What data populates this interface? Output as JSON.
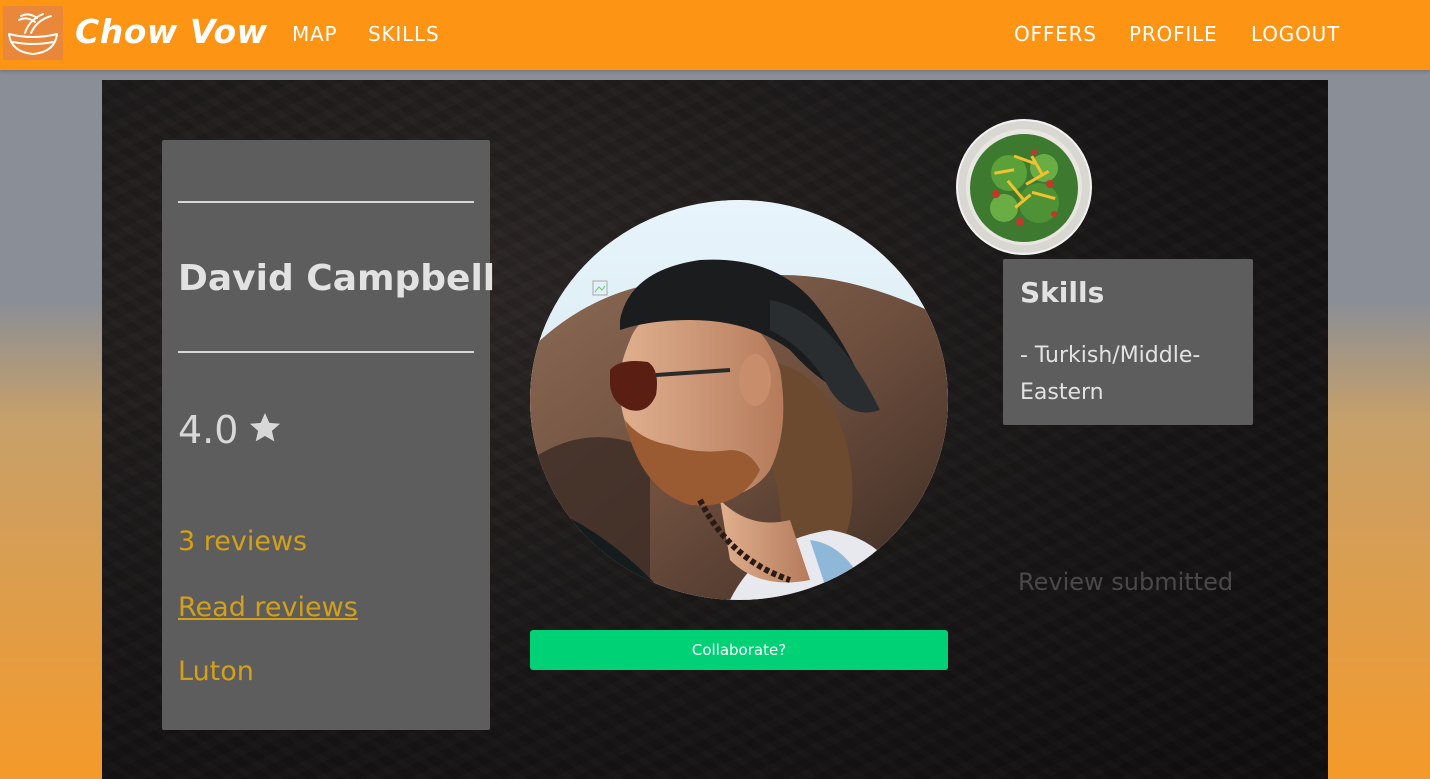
{
  "brand": {
    "name": "Chow Vow",
    "logo_icon": "noodle-bowl-icon"
  },
  "nav": {
    "left": [
      "MAP",
      "SKILLS"
    ],
    "right": [
      "OFFERS",
      "PROFILE",
      "LOGOUT"
    ]
  },
  "profile": {
    "name": "David Campbell",
    "rating": "4.0",
    "rating_icon": "star-icon",
    "reviews_count": "3 reviews",
    "read_reviews_label": "Read reviews",
    "location": "Luton",
    "avatar_icon": "profile-photo"
  },
  "collaborate_label": "Collaborate?",
  "skills": {
    "title": "Skills",
    "items": [
      "- Turkish/Middle-Eastern"
    ]
  },
  "review_status": "Review submitted",
  "colors": {
    "navbar": "#fd9414",
    "accent_gold": "#d4a017",
    "button_green": "#00d174",
    "card_gray": "#5e5d5d"
  }
}
